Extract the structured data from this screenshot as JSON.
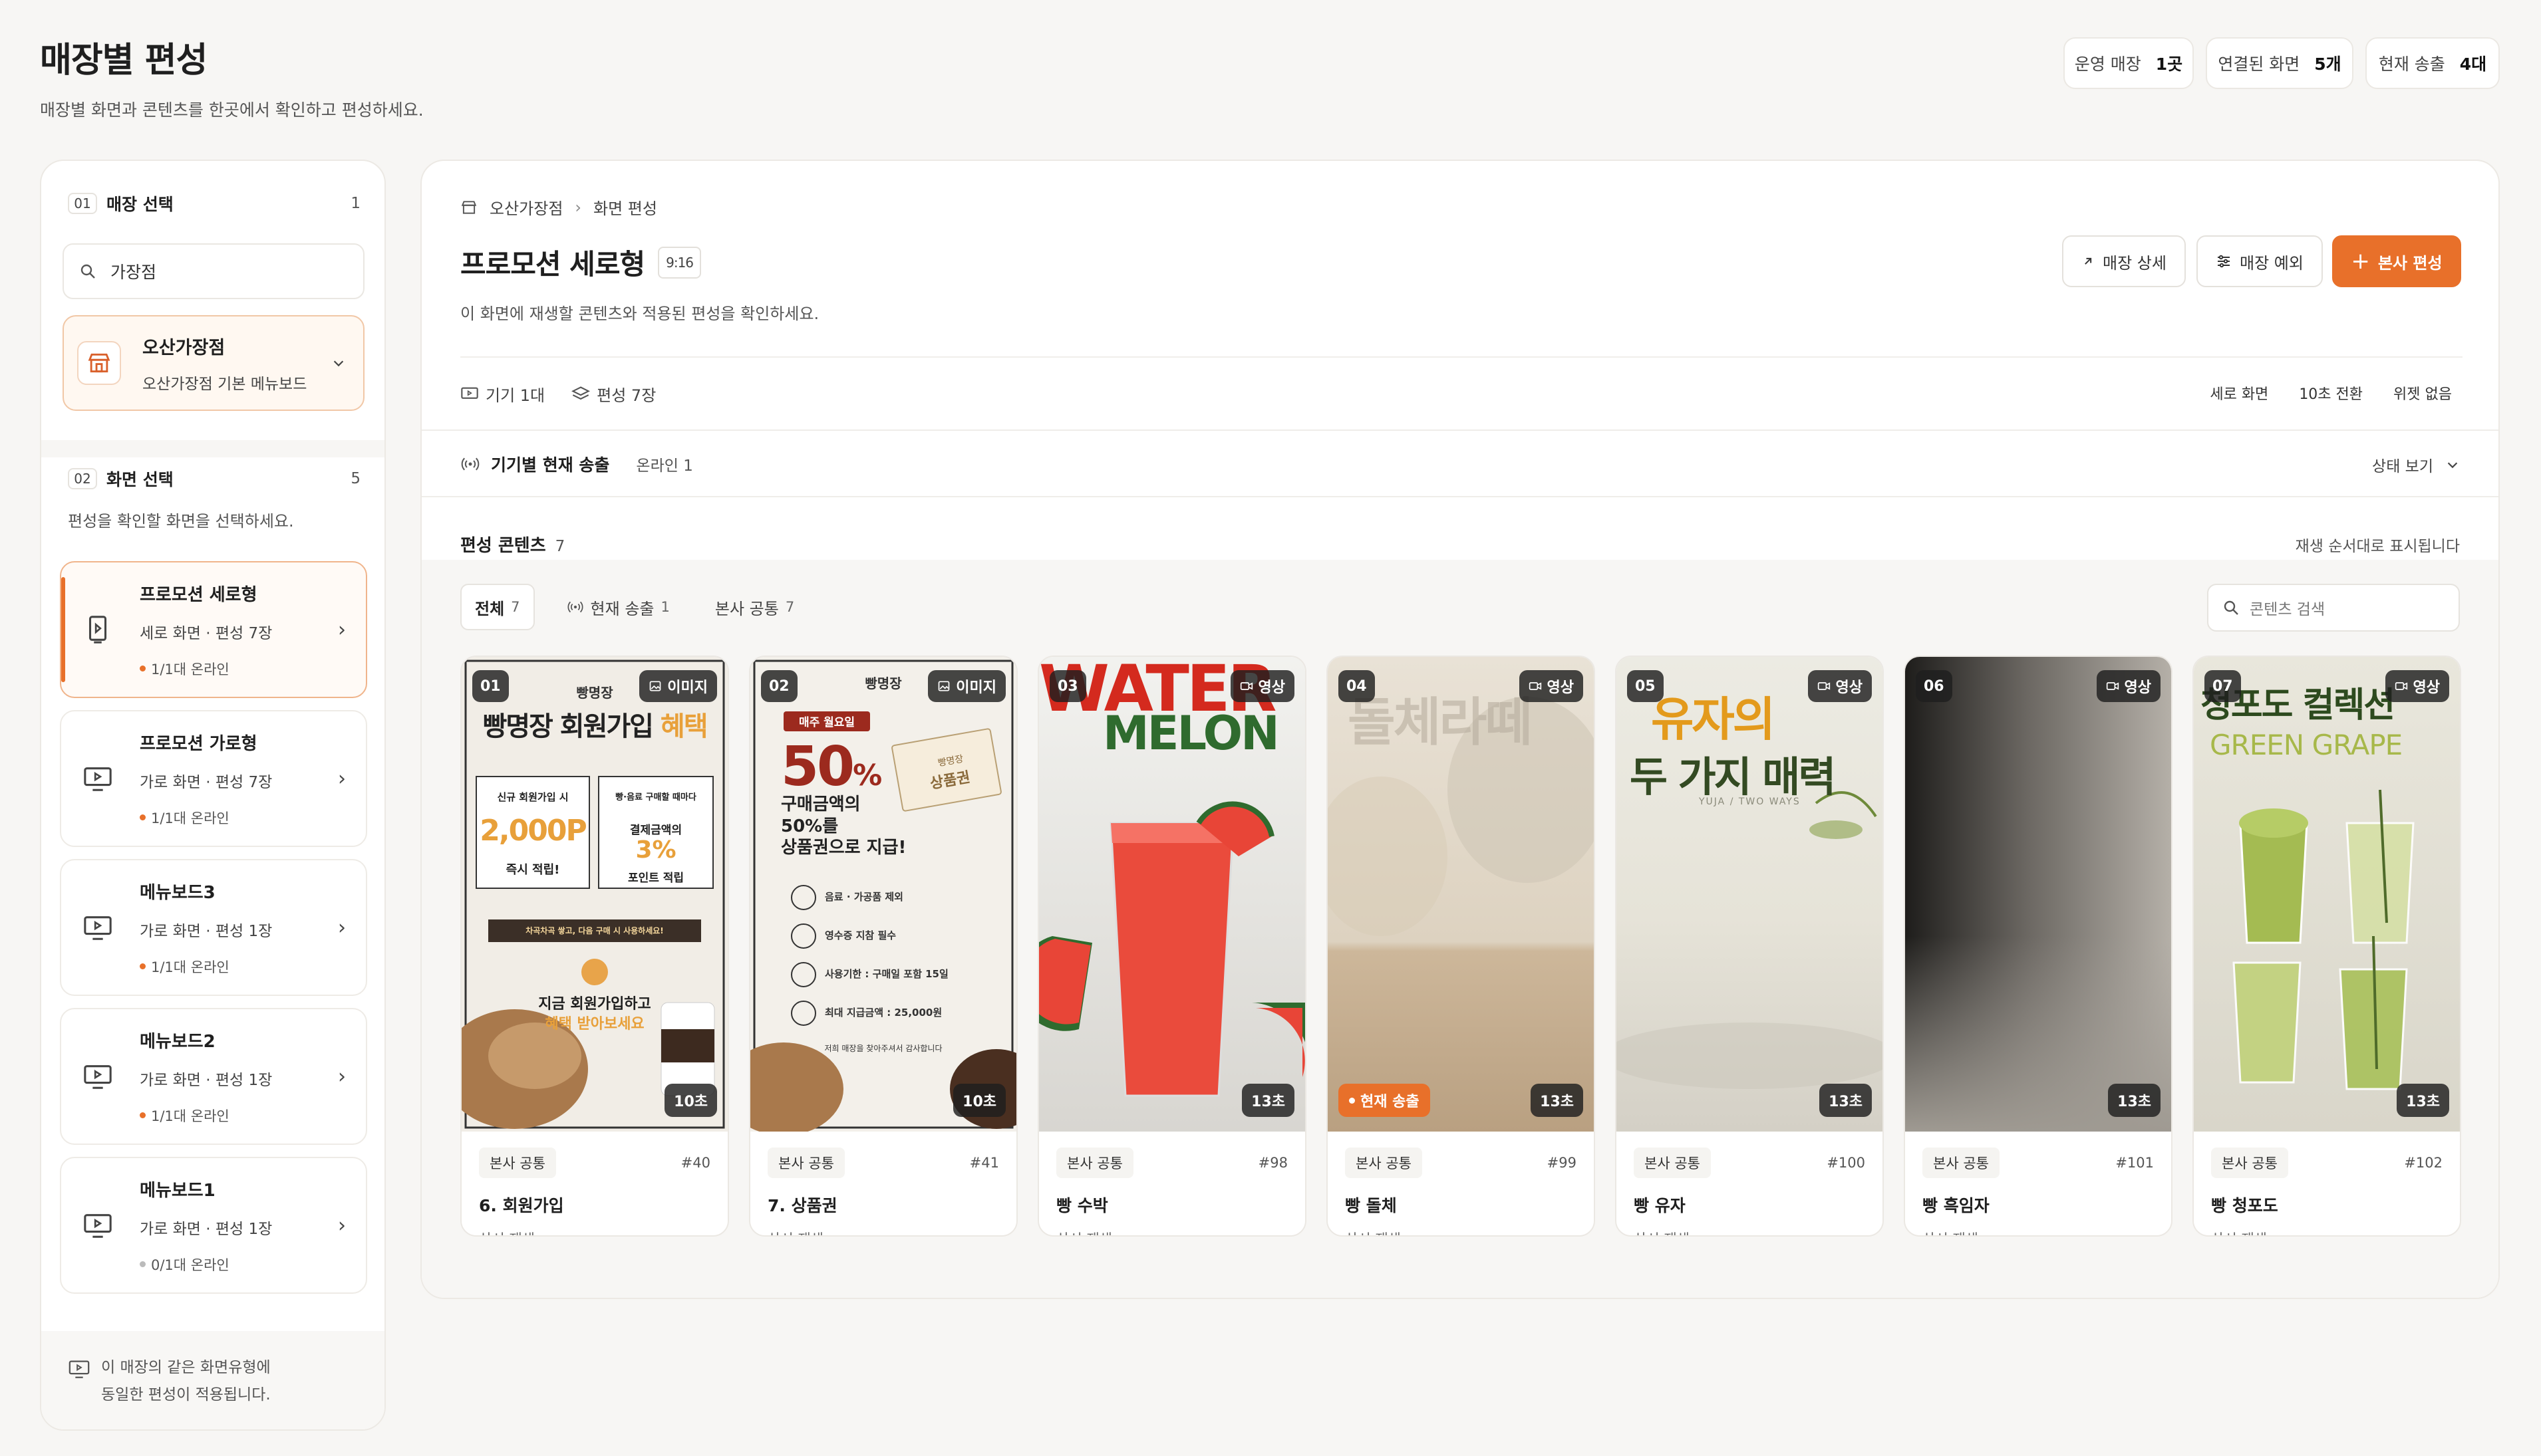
{
  "header": {
    "title": "매장별 편성",
    "subtitle": "매장별 화면과 콘텐츠를 한곳에서 확인하고 편성하세요.",
    "stats": [
      {
        "label": "운영 매장",
        "value": "1곳"
      },
      {
        "label": "연결된 화면",
        "value": "5개"
      },
      {
        "label": "현재 송출",
        "value": "4대"
      }
    ]
  },
  "left": {
    "store_section": {
      "step": "01",
      "title": "매장 선택",
      "count": "1"
    },
    "search_value": "가장점",
    "selected_store": {
      "name": "오산가장점",
      "board": "오산가장점 기본 메뉴보드"
    },
    "screen_section": {
      "step": "02",
      "title": "화면 선택",
      "count": "5",
      "hint": "편성을 확인할 화면을 선택하세요."
    },
    "screens": [
      {
        "title": "프로모션 세로형",
        "sub": "세로 화면 · 편성 7장",
        "status": "1/1대 온라인",
        "online": true
      },
      {
        "title": "프로모션 가로형",
        "sub": "가로 화면 · 편성 7장",
        "status": "1/1대 온라인",
        "online": true
      },
      {
        "title": "메뉴보드3",
        "sub": "가로 화면 · 편성 1장",
        "status": "1/1대 온라인",
        "online": true
      },
      {
        "title": "메뉴보드2",
        "sub": "가로 화면 · 편성 1장",
        "status": "1/1대 온라인",
        "online": true
      },
      {
        "title": "메뉴보드1",
        "sub": "가로 화면 · 편성 1장",
        "status": "0/1대 온라인",
        "online": false
      }
    ],
    "footer_line1": "이 매장의 같은 화면유형에",
    "footer_line2": "동일한 편성이 적용됩니다."
  },
  "main": {
    "breadcrumb": [
      "오산가장점",
      "화면 편성"
    ],
    "title": "프로모션 세로형",
    "ratio": "9:16",
    "subtitle": "이 화면에 재생할 콘텐츠와 적용된 편성을 확인하세요.",
    "buttons": {
      "detail": "매장 상세",
      "exception": "매장 예외",
      "hq_edit": "본사 편성"
    },
    "meta": {
      "devices": "기기 1대",
      "schedules": "편성 7장"
    },
    "meta_tags": [
      "세로 화면",
      "10초 전환",
      "위젯 없음"
    ],
    "live": {
      "label": "기기별 현재 송출",
      "online": "온라인 1",
      "status_view": "상태 보기"
    },
    "contents": {
      "title": "편성 콘텐츠",
      "count": "7",
      "order_note": "재생 순서대로 표시됩니다",
      "search_placeholder": "콘텐츠 검색",
      "tabs": [
        {
          "label": "전체",
          "count": "7"
        },
        {
          "label": "현재 송출",
          "count": "1"
        },
        {
          "label": "본사 공통",
          "count": "7"
        }
      ],
      "items": [
        {
          "num": "01",
          "type": "이미지",
          "duration": "10초",
          "tag": "본사 공통",
          "id": "#40",
          "name": "6. 회원가입",
          "play": "상시 재생",
          "live": false
        },
        {
          "num": "02",
          "type": "이미지",
          "duration": "10초",
          "tag": "본사 공통",
          "id": "#41",
          "name": "7. 상품권",
          "play": "상시 재생",
          "live": false
        },
        {
          "num": "03",
          "type": "영상",
          "duration": "13초",
          "tag": "본사 공통",
          "id": "#98",
          "name": "빵 수박",
          "play": "상시 재생",
          "live": false
        },
        {
          "num": "04",
          "type": "영상",
          "duration": "13초",
          "tag": "본사 공통",
          "id": "#99",
          "name": "빵 돌체",
          "play": "상시 재생",
          "live": true,
          "live_label": "현재 송출"
        },
        {
          "num": "05",
          "type": "영상",
          "duration": "13초",
          "tag": "본사 공통",
          "id": "#100",
          "name": "빵 유자",
          "play": "상시 재생",
          "live": false
        },
        {
          "num": "06",
          "type": "영상",
          "duration": "13초",
          "tag": "본사 공통",
          "id": "#101",
          "name": "빵 흑임자",
          "play": "상시 재생",
          "live": false
        },
        {
          "num": "07",
          "type": "영상",
          "duration": "13초",
          "tag": "본사 공통",
          "id": "#102",
          "name": "빵 청포도",
          "play": "상시 재생",
          "live": false
        }
      ]
    },
    "posters": {
      "p1": {
        "brand": "빵명장",
        "headline": "빵명장 회원가입",
        "accent": "혜택",
        "box1_top": "신규 회원가입 시",
        "box1_big": "2,000P",
        "box1_bot": "즉시 적립!",
        "box2_top": "빵·음료 구매할 때마다",
        "box2_mid": "결제금액의",
        "box2_big": "3%",
        "box2_bot": "포인트 적립",
        "banner": "차곡차곡 쌓고, 다음 구매 시 사용하세요!",
        "cta1": "지금 회원가입하고",
        "cta2": "혜택 받아보세요"
      },
      "p2": {
        "brand": "빵명장",
        "pill": "매주 월요일",
        "big": "50",
        "pct": "%",
        "line1": "구매금액의",
        "line2": "50%를",
        "line3": "상품권으로 지급!",
        "voucher": "상품권",
        "voucher_top": "빵명장",
        "rules": [
          "음료 · 가공품 제외",
          "영수증 지참 필수",
          "사용기한 : 구매일 포함 15일",
          "최대 지급금액 : 25,000원"
        ],
        "note": "저희 매장을 찾아주셔서 감사합니다"
      },
      "p3": {
        "word1": "WATER",
        "word2": "MELON"
      },
      "p4": {
        "word": "돌체라떼"
      },
      "p5": {
        "line1": "유자의",
        "line2": "두 가지 매력",
        "small": "YUJA / TWO WAYS"
      },
      "p7": {
        "line1": "청포도 컬렉션",
        "line2": "GREEN GRAPE"
      }
    }
  },
  "colors": {
    "accent": "#e8702a",
    "live": "#e8702a",
    "text": "#1f1f1f"
  }
}
